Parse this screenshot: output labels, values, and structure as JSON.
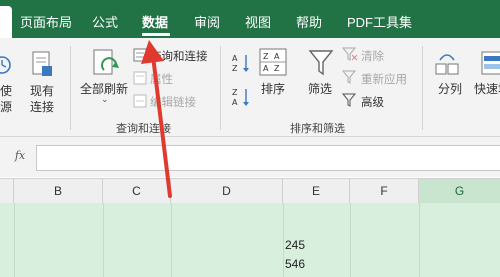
{
  "menu": {
    "tabs": [
      {
        "label": "页面布局"
      },
      {
        "label": "公式"
      },
      {
        "label": "数据"
      },
      {
        "label": "审阅"
      },
      {
        "label": "视图"
      },
      {
        "label": "帮助"
      },
      {
        "label": "PDF工具集"
      }
    ],
    "active_tab": "数据"
  },
  "ribbon": {
    "get_data": {
      "line1": "使",
      "line2": "源"
    },
    "existing_connections": {
      "line1": "现有",
      "line2": "连接"
    },
    "refresh_all": {
      "label": "全部刷新"
    },
    "queries_connections": {
      "label": "查询和连接"
    },
    "properties": {
      "label": "属性"
    },
    "edit_links": {
      "label": "编辑链接"
    },
    "group_queries": "查询和连接",
    "sort": {
      "label": "排序"
    },
    "filter": {
      "label": "筛选"
    },
    "clear": {
      "label": "清除"
    },
    "reapply": {
      "label": "重新应用"
    },
    "advanced": {
      "label": "高级"
    },
    "group_sort_filter": "排序和筛选",
    "text_to_columns": {
      "label": "分列"
    },
    "flash_fill": {
      "label": "快速填"
    }
  },
  "formula_bar": {
    "fx": "fx",
    "value": ""
  },
  "columns": [
    "B",
    "C",
    "D",
    "E",
    "F",
    "G"
  ],
  "selected_column": "G",
  "cells": [
    {
      "col": "E",
      "value": "245"
    },
    {
      "col": "E",
      "value": "546"
    }
  ],
  "colors": {
    "accent": "#217346",
    "selection": "#d7efdc",
    "arrow": "#e03a30"
  }
}
